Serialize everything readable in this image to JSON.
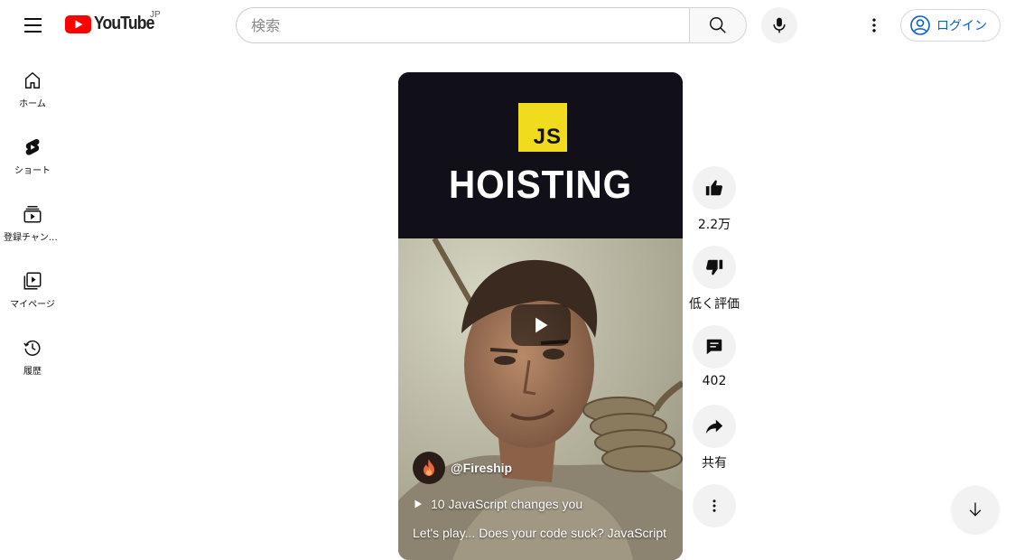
{
  "header": {
    "logo_text": "YouTube",
    "country_code": "JP",
    "search_placeholder": "検索",
    "login_label": "ログイン"
  },
  "sidebar": {
    "items": [
      {
        "label": "ホーム",
        "icon": "home-icon"
      },
      {
        "label": "ショート",
        "icon": "shorts-icon"
      },
      {
        "label": "登録チャンネル",
        "icon": "subscriptions-icon"
      },
      {
        "label": "マイページ",
        "icon": "library-icon"
      },
      {
        "label": "履歴",
        "icon": "history-icon"
      }
    ]
  },
  "short": {
    "badge_text": "JS",
    "headline": "HOISTING",
    "channel": "@Fireship",
    "related_video": "10 JavaScript changes you",
    "title": "Let's play... Does your code suck? JavaScript"
  },
  "actions": {
    "like_count": "2.2万",
    "dislike_label": "低く評価",
    "comment_count": "402",
    "share_label": "共有"
  },
  "colors": {
    "brand_red": "#ff0000",
    "link_blue": "#065fd4",
    "js_yellow": "#f0db1e"
  }
}
